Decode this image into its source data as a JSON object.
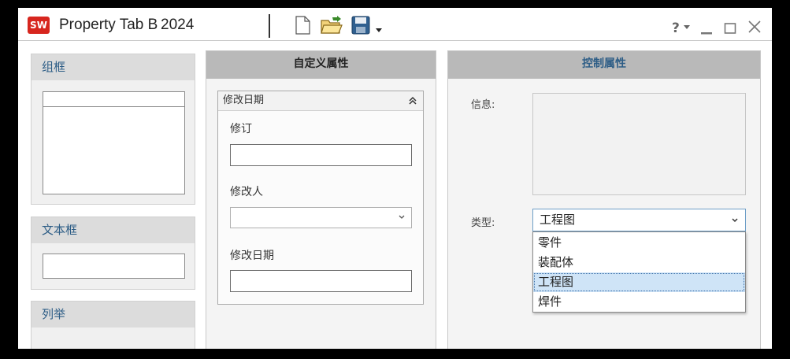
{
  "window": {
    "logo_text": "SW",
    "title": "Property Tab Builder",
    "year": "2024"
  },
  "toolbar": {
    "icons": [
      "new-document-icon",
      "open-folder-icon",
      "save-icon",
      "save-dropdown-arrow-icon"
    ]
  },
  "window_controls": {
    "icons": [
      "help-icon",
      "minimize-icon",
      "maximize-icon",
      "close-icon"
    ]
  },
  "palette": {
    "items": [
      {
        "label": "组框"
      },
      {
        "label": "文本框"
      },
      {
        "label": "列举"
      }
    ]
  },
  "custom_panel": {
    "title": "自定义属性",
    "group": {
      "title": "修改日期",
      "fields": [
        {
          "label": "修订",
          "kind": "text",
          "value": ""
        },
        {
          "label": "修改人",
          "kind": "dropdown",
          "value": ""
        },
        {
          "label": "修改日期",
          "kind": "text",
          "value": ""
        }
      ]
    }
  },
  "control_panel": {
    "title": "控制属性",
    "info_label": "信息:",
    "type_label": "类型:",
    "type_selected": "工程图",
    "type_options": [
      "零件",
      "装配体",
      "工程图",
      "焊件"
    ],
    "accent_color": "#2d5d86",
    "selection_color": "#cfe4f7"
  }
}
